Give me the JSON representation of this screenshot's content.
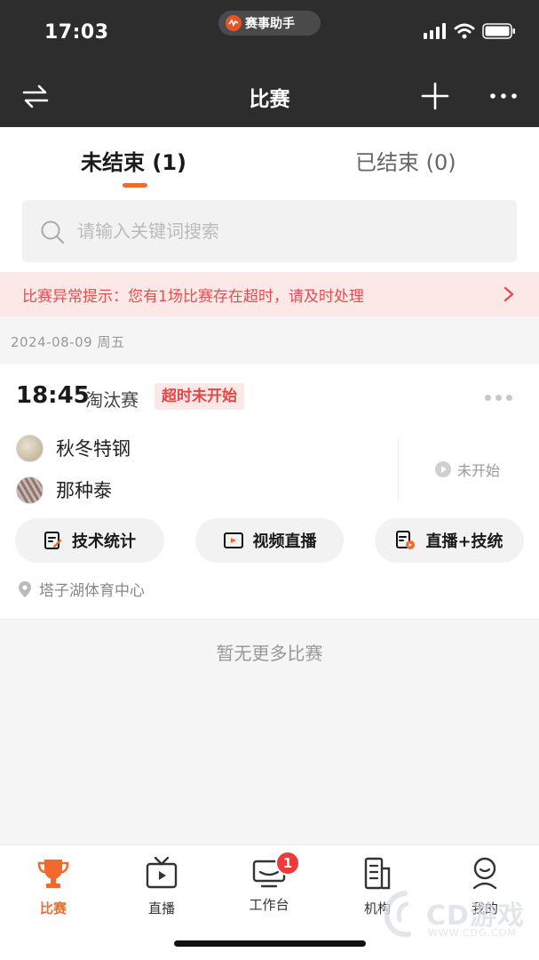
{
  "status_bar": {
    "time": "17:03",
    "app_name": "赛事助手"
  },
  "nav": {
    "title": "比赛"
  },
  "tabs": [
    {
      "label": "未结束 (1)",
      "active": true
    },
    {
      "label": "已结束 (0)",
      "active": false
    }
  ],
  "search": {
    "placeholder": "请输入关键词搜索",
    "value": ""
  },
  "alert": {
    "text": "比赛异常提示：您有1场比赛存在超时，请及时处理"
  },
  "date_header": "2024-08-09 周五",
  "match": {
    "time": "18:45",
    "round": "淘汰赛",
    "badge": "超时未开始",
    "players": [
      "秋冬特钢",
      "那种泰"
    ],
    "status": "未开始",
    "actions": [
      "技术统计",
      "视频直播",
      "直播+技统"
    ],
    "venue": "塔子湖体育中心"
  },
  "empty_text": "暂无更多比赛",
  "tabbar": [
    {
      "label": "比赛",
      "icon": "trophy-icon",
      "active": true
    },
    {
      "label": "直播",
      "icon": "tv-icon",
      "active": false
    },
    {
      "label": "工作台",
      "icon": "monitor-icon",
      "active": false,
      "badge": "1"
    },
    {
      "label": "机构",
      "icon": "building-icon",
      "active": false
    },
    {
      "label": "我的",
      "icon": "user-icon",
      "active": false
    }
  ],
  "watermark": {
    "brand": "CD游戏",
    "url": "WWW.CDG.COM"
  },
  "colors": {
    "accent": "#ef6a2c",
    "alert_text": "#e05050",
    "nav_bg": "#2d2d2d"
  }
}
